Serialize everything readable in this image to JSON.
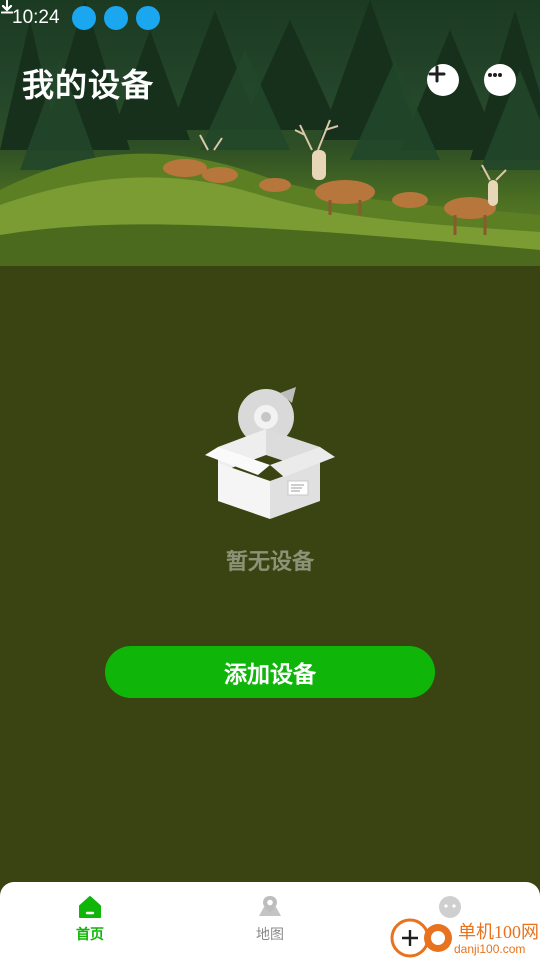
{
  "status_bar": {
    "time": "10:24",
    "icons": [
      "download-icon",
      "download-icon",
      "download-icon"
    ]
  },
  "header": {
    "title": "我的设备",
    "add_icon": "plus-icon",
    "message_icon": "chat-bubble-icon"
  },
  "empty_state": {
    "text": "暂无设备",
    "illustration": "empty-box-icon"
  },
  "actions": {
    "add_device_label": "添加设备"
  },
  "tabbar": {
    "items": [
      {
        "label": "首页",
        "icon": "home-icon",
        "active": true
      },
      {
        "label": "地图",
        "icon": "map-pin-icon",
        "active": false
      },
      {
        "label": "",
        "icon": "profile-icon",
        "active": false
      }
    ]
  },
  "watermark": {
    "line1": "单机100网",
    "line2": "danji100.com"
  },
  "colors": {
    "accent": "#10b50a",
    "background": "#3a4312",
    "status_icon": "#1aa7f0",
    "tab_inactive": "#8a8a8a"
  }
}
